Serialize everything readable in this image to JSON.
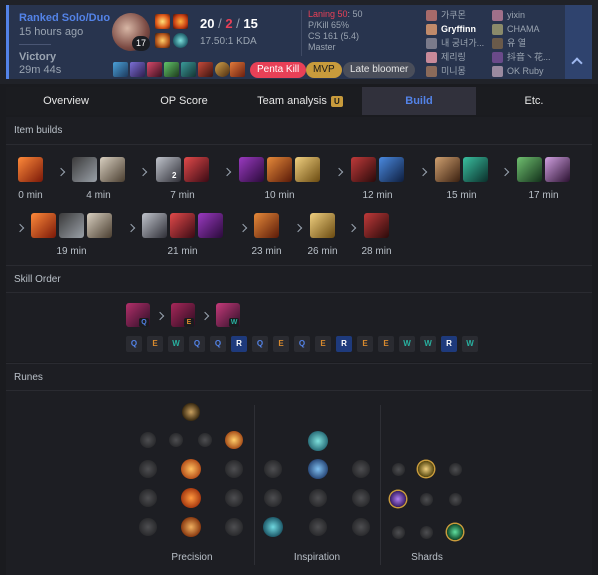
{
  "match": {
    "queue": "Ranked Solo/Duo",
    "time_ago": "15 hours ago",
    "result": "Victory",
    "duration": "29m 44s",
    "champion_level": "17",
    "kills": "20",
    "deaths": "2",
    "assists": "15",
    "kda_ratio": "17.50:1 KDA",
    "laning_label": "Laning 50",
    "laning_tail": ": 50",
    "pkill": "P/Kill 65%",
    "cs": "CS 161 (5.4)",
    "rank": "Master",
    "badges": [
      "Penta Kill",
      "MVP",
      "Late bloomer"
    ],
    "colors": {
      "accent": "#5383e8",
      "death": "#e84057",
      "penta": "#e84057",
      "mvp": "#c89b3c"
    }
  },
  "players": {
    "team1": [
      "가쿠몬",
      "Gryffinn",
      "내 궁녀가...",
      "제리링",
      "미니몽"
    ],
    "team2": [
      "yixin",
      "CHAMA",
      "유 열",
      "抖音丶花...",
      "OK Ruby"
    ]
  },
  "tabs": [
    {
      "label": "Overview"
    },
    {
      "label": "OP Score"
    },
    {
      "label": "Team analysis",
      "badge": "U"
    },
    {
      "label": "Build"
    },
    {
      "label": "Etc."
    }
  ],
  "sections": {
    "items": "Item builds",
    "skills": "Skill Order",
    "runes": "Runes"
  },
  "item_builds": [
    {
      "time": "0 min",
      "count": 1
    },
    {
      "time": "4 min",
      "count": 2
    },
    {
      "time": "7 min",
      "count": 2,
      "qty": "2"
    },
    {
      "time": "10 min",
      "count": 3
    },
    {
      "time": "12 min",
      "count": 2
    },
    {
      "time": "15 min",
      "count": 2
    },
    {
      "time": "17 min",
      "count": 2
    },
    {
      "time": "19 min",
      "count": 3
    },
    {
      "time": "21 min",
      "count": 3
    },
    {
      "time": "23 min",
      "count": 1
    },
    {
      "time": "26 min",
      "count": 1
    },
    {
      "time": "28 min",
      "count": 1
    }
  ],
  "skill_priority": [
    "Q",
    "E",
    "W"
  ],
  "skill_order": [
    "Q",
    "E",
    "W",
    "Q",
    "Q",
    "R",
    "Q",
    "E",
    "Q",
    "E",
    "R",
    "E",
    "E",
    "W",
    "W",
    "R",
    "W"
  ],
  "skill_colors": {
    "Q": "#5383e8",
    "W": "#28b0a0",
    "E": "#d88a2e",
    "R": "#ffffff"
  },
  "runes": {
    "primary": "Precision",
    "secondary": "Inspiration",
    "shards": "Shards"
  }
}
